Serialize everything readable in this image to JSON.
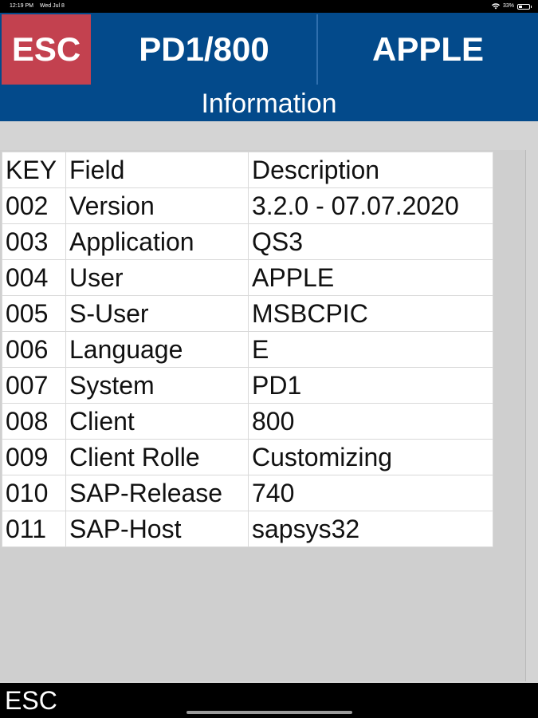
{
  "status_bar": {
    "time": "12:19 PM",
    "date": "Wed Jul 8",
    "battery": "33%",
    "battery_level": 0.33
  },
  "header": {
    "esc_label": "ESC",
    "system_client": "PD1/800",
    "user": "APPLE",
    "page_title": "Information",
    "colors": {
      "header_bg": "#034a8b",
      "esc_bg": "#c3414f"
    }
  },
  "table": {
    "headers": [
      "KEY",
      "Field",
      "Description"
    ],
    "rows": [
      [
        "002",
        "Version",
        "3.2.0 - 07.07.2020"
      ],
      [
        "003",
        "Application",
        "QS3"
      ],
      [
        "004",
        "User",
        "APPLE"
      ],
      [
        "005",
        "S-User",
        "MSBCPIC"
      ],
      [
        "006",
        "Language",
        "E"
      ],
      [
        "007",
        "System",
        "PD1"
      ],
      [
        "008",
        "Client",
        "800"
      ],
      [
        "009",
        "Client Rolle",
        "Customizing"
      ],
      [
        "010",
        "SAP-Release",
        "740"
      ],
      [
        "011",
        "SAP-Host",
        "sapsys32"
      ]
    ]
  },
  "footer": {
    "esc_label": "ESC"
  }
}
